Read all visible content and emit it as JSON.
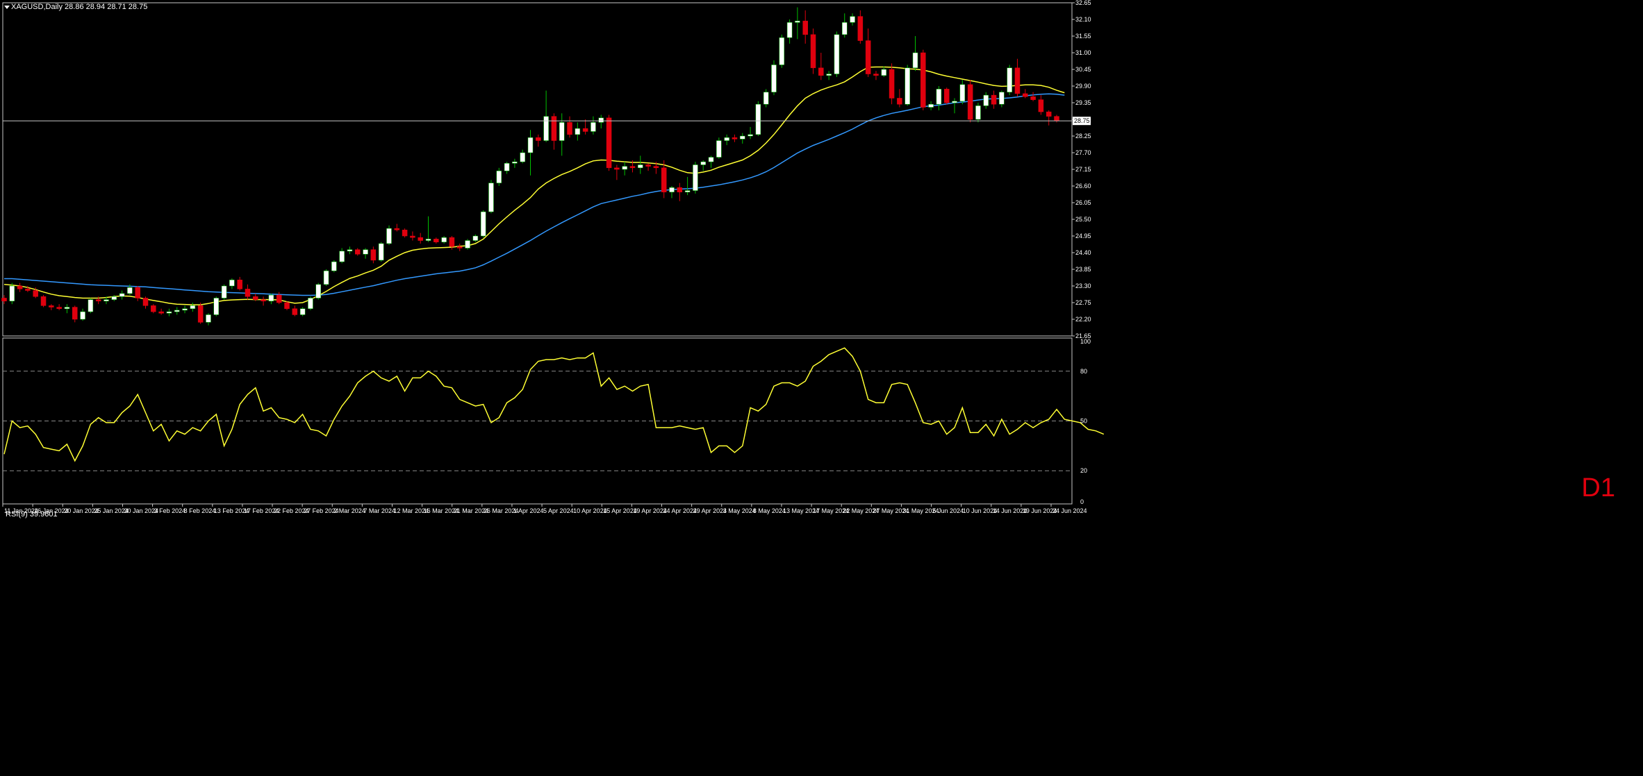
{
  "colors": {
    "background": "#000000",
    "frame": "#c8c8c8",
    "grid": "#8a8a8a",
    "bull": "#ffffff",
    "bear": "#e0000e",
    "wick_bull": "#00c000",
    "wick_bear": "#e0000e",
    "ma_fast": "#ffff33",
    "ma_slow": "#3399ff",
    "rsi_line": "#ffff33",
    "price_line": "#c8c8c8",
    "timeframe": "#e0000e"
  },
  "header": {
    "symbol_timeframe": "XAGUSD,Daily",
    "ohlc": "28.86 28.94 28.71 28.75"
  },
  "timeframe_label": "D1",
  "current_price_label": "28.75",
  "rsi_panel": {
    "label": "RSI(9) 39.9601"
  },
  "chart_data": [
    {
      "type": "candlestick",
      "title": "XAGUSD,Daily",
      "y_range": [
        21.65,
        32.65
      ],
      "y_ticks": [
        "32.65",
        "32.10",
        "31.55",
        "31.00",
        "30.45",
        "29.90",
        "29.35",
        "28.80",
        "28.25",
        "27.70",
        "27.15",
        "26.60",
        "26.05",
        "25.50",
        "24.95",
        "24.40",
        "23.85",
        "23.30",
        "22.75",
        "22.20",
        "21.65"
      ],
      "x_labels": [
        "11 Jan 2024",
        "16 Jan 2024",
        "20 Jan 2024",
        "25 Jan 2024",
        "30 Jan 2024",
        "3 Feb 2024",
        "8 Feb 2024",
        "13 Feb 2024",
        "17 Feb 2024",
        "22 Feb 2024",
        "27 Feb 2024",
        "2 Mar 2024",
        "7 Mar 2024",
        "12 Mar 2024",
        "16 Mar 2024",
        "21 Mar 2024",
        "26 Mar 2024",
        "1 Apr 2024",
        "5 Apr 2024",
        "10 Apr 2024",
        "15 Apr 2024",
        "19 Apr 2024",
        "24 Apr 2024",
        "29 Apr 2024",
        "3 May 2024",
        "8 May 2024",
        "13 May 2024",
        "17 May 2024",
        "22 May 2024",
        "27 May 2024",
        "31 May 2024",
        "5 Jun 2024",
        "10 Jun 2024",
        "14 Jun 2024",
        "19 Jun 2024",
        "24 Jun 2024"
      ],
      "current_price": 28.75,
      "candles": [
        [
          22.9,
          23.0,
          22.7,
          22.8
        ],
        [
          22.8,
          23.4,
          22.7,
          23.3
        ],
        [
          23.3,
          23.4,
          23.1,
          23.2
        ],
        [
          23.2,
          23.3,
          23.1,
          23.15
        ],
        [
          23.15,
          23.25,
          22.9,
          22.95
        ],
        [
          22.95,
          23.0,
          22.6,
          22.65
        ],
        [
          22.65,
          22.7,
          22.5,
          22.6
        ],
        [
          22.6,
          22.7,
          22.5,
          22.55
        ],
        [
          22.55,
          22.7,
          22.4,
          22.6
        ],
        [
          22.6,
          22.65,
          22.1,
          22.2
        ],
        [
          22.2,
          22.55,
          22.15,
          22.45
        ],
        [
          22.45,
          22.9,
          22.4,
          22.85
        ],
        [
          22.85,
          22.95,
          22.7,
          22.8
        ],
        [
          22.8,
          22.95,
          22.7,
          22.85
        ],
        [
          22.85,
          23.0,
          22.8,
          22.95
        ],
        [
          22.95,
          23.15,
          22.85,
          23.05
        ],
        [
          23.05,
          23.35,
          23.0,
          23.25
        ],
        [
          23.25,
          23.3,
          22.8,
          22.9
        ],
        [
          22.9,
          22.95,
          22.55,
          22.65
        ],
        [
          22.65,
          22.7,
          22.4,
          22.45
        ],
        [
          22.45,
          22.55,
          22.35,
          22.4
        ],
        [
          22.4,
          22.55,
          22.3,
          22.45
        ],
        [
          22.45,
          22.6,
          22.35,
          22.5
        ],
        [
          22.5,
          22.65,
          22.4,
          22.55
        ],
        [
          22.55,
          22.75,
          22.45,
          22.65
        ],
        [
          22.65,
          22.75,
          22.05,
          22.1
        ],
        [
          22.1,
          22.4,
          22.0,
          22.35
        ],
        [
          22.35,
          22.95,
          22.3,
          22.9
        ],
        [
          22.9,
          23.35,
          22.85,
          23.3
        ],
        [
          23.3,
          23.55,
          23.2,
          23.5
        ],
        [
          23.5,
          23.6,
          23.15,
          23.2
        ],
        [
          23.2,
          23.35,
          22.85,
          22.95
        ],
        [
          22.95,
          23.05,
          22.8,
          22.85
        ],
        [
          22.85,
          22.95,
          22.65,
          22.8
        ],
        [
          22.8,
          23.05,
          22.7,
          23.0
        ],
        [
          23.0,
          23.1,
          22.7,
          22.75
        ],
        [
          22.75,
          22.8,
          22.5,
          22.55
        ],
        [
          22.55,
          22.65,
          22.3,
          22.35
        ],
        [
          22.35,
          22.6,
          22.3,
          22.55
        ],
        [
          22.55,
          22.95,
          22.5,
          22.9
        ],
        [
          22.9,
          23.4,
          22.85,
          23.35
        ],
        [
          23.35,
          23.85,
          23.3,
          23.8
        ],
        [
          23.8,
          24.15,
          23.75,
          24.1
        ],
        [
          24.1,
          24.55,
          24.05,
          24.45
        ],
        [
          24.45,
          24.6,
          24.35,
          24.5
        ],
        [
          24.5,
          24.55,
          24.3,
          24.35
        ],
        [
          24.35,
          24.55,
          24.2,
          24.5
        ],
        [
          24.5,
          24.6,
          24.05,
          24.15
        ],
        [
          24.15,
          24.75,
          24.1,
          24.7
        ],
        [
          24.7,
          25.3,
          24.65,
          25.2
        ],
        [
          25.2,
          25.35,
          25.1,
          25.15
        ],
        [
          25.15,
          25.2,
          24.9,
          24.95
        ],
        [
          24.95,
          25.1,
          24.8,
          24.9
        ],
        [
          24.9,
          25.05,
          24.7,
          24.8
        ],
        [
          24.8,
          25.6,
          24.75,
          24.85
        ],
        [
          24.85,
          24.9,
          24.7,
          24.75
        ],
        [
          24.75,
          24.95,
          24.7,
          24.9
        ],
        [
          24.9,
          24.95,
          24.5,
          24.6
        ],
        [
          24.6,
          24.7,
          24.45,
          24.55
        ],
        [
          24.55,
          24.85,
          24.5,
          24.8
        ],
        [
          24.8,
          25.0,
          24.75,
          24.95
        ],
        [
          24.95,
          25.8,
          24.9,
          25.75
        ],
        [
          25.75,
          26.8,
          25.7,
          26.7
        ],
        [
          26.7,
          27.2,
          26.6,
          27.1
        ],
        [
          27.1,
          27.4,
          27.0,
          27.35
        ],
        [
          27.35,
          27.5,
          27.2,
          27.4
        ],
        [
          27.4,
          27.8,
          27.35,
          27.7
        ],
        [
          27.7,
          28.45,
          26.95,
          28.2
        ],
        [
          28.2,
          28.3,
          27.9,
          28.1
        ],
        [
          28.1,
          29.75,
          28.05,
          28.9
        ],
        [
          28.9,
          29.0,
          27.8,
          28.1
        ],
        [
          28.1,
          29.0,
          27.6,
          28.7
        ],
        [
          28.7,
          28.9,
          28.2,
          28.3
        ],
        [
          28.3,
          28.7,
          28.1,
          28.5
        ],
        [
          28.5,
          28.8,
          28.3,
          28.4
        ],
        [
          28.4,
          28.9,
          28.3,
          28.7
        ],
        [
          28.7,
          28.95,
          28.5,
          28.85
        ],
        [
          28.85,
          28.95,
          27.1,
          27.2
        ],
        [
          27.2,
          27.3,
          26.8,
          27.15
        ],
        [
          27.15,
          27.4,
          26.95,
          27.25
        ],
        [
          27.25,
          27.45,
          27.05,
          27.2
        ],
        [
          27.2,
          27.6,
          27.0,
          27.3
        ],
        [
          27.3,
          27.35,
          27.1,
          27.25
        ],
        [
          27.25,
          27.4,
          27.0,
          27.2
        ],
        [
          27.2,
          27.45,
          26.2,
          26.4
        ],
        [
          26.4,
          26.6,
          26.2,
          26.55
        ],
        [
          26.55,
          26.7,
          26.1,
          26.4
        ],
        [
          26.4,
          26.9,
          26.3,
          26.45
        ],
        [
          26.45,
          27.4,
          26.35,
          27.3
        ],
        [
          27.3,
          27.45,
          27.1,
          27.4
        ],
        [
          27.4,
          27.6,
          27.2,
          27.55
        ],
        [
          27.55,
          28.2,
          27.5,
          28.1
        ],
        [
          28.1,
          28.3,
          27.95,
          28.2
        ],
        [
          28.2,
          28.3,
          28.05,
          28.15
        ],
        [
          28.15,
          28.35,
          28.0,
          28.25
        ],
        [
          28.25,
          28.55,
          28.15,
          28.3
        ],
        [
          28.3,
          29.4,
          28.25,
          29.3
        ],
        [
          29.3,
          29.8,
          29.2,
          29.7
        ],
        [
          29.7,
          30.75,
          29.6,
          30.6
        ],
        [
          30.6,
          31.6,
          30.5,
          31.5
        ],
        [
          31.5,
          32.1,
          31.3,
          32.0
        ],
        [
          32.0,
          32.5,
          31.45,
          32.05
        ],
        [
          32.05,
          32.4,
          31.3,
          31.6
        ],
        [
          31.6,
          31.8,
          30.3,
          30.5
        ],
        [
          30.5,
          31.0,
          30.1,
          30.25
        ],
        [
          30.25,
          30.4,
          30.1,
          30.3
        ],
        [
          30.3,
          31.7,
          30.2,
          31.6
        ],
        [
          31.6,
          32.3,
          31.5,
          32.0
        ],
        [
          32.0,
          32.3,
          31.9,
          32.2
        ],
        [
          32.2,
          32.4,
          31.3,
          31.4
        ],
        [
          31.4,
          31.8,
          30.2,
          30.3
        ],
        [
          30.3,
          30.4,
          30.1,
          30.25
        ],
        [
          30.25,
          30.55,
          30.2,
          30.45
        ],
        [
          30.45,
          30.65,
          29.3,
          29.5
        ],
        [
          29.5,
          29.8,
          29.2,
          29.3
        ],
        [
          29.3,
          30.6,
          29.25,
          30.5
        ],
        [
          30.5,
          31.55,
          30.4,
          31.0
        ],
        [
          31.0,
          31.1,
          29.1,
          29.2
        ],
        [
          29.2,
          29.4,
          29.1,
          29.3
        ],
        [
          29.3,
          29.9,
          29.1,
          29.8
        ],
        [
          29.8,
          29.85,
          29.3,
          29.35
        ],
        [
          29.35,
          29.5,
          29.0,
          29.4
        ],
        [
          29.4,
          30.1,
          29.3,
          29.95
        ],
        [
          29.95,
          30.1,
          28.7,
          28.8
        ],
        [
          28.8,
          29.35,
          28.7,
          29.25
        ],
        [
          29.25,
          29.7,
          29.15,
          29.6
        ],
        [
          29.6,
          29.75,
          29.15,
          29.3
        ],
        [
          29.3,
          29.75,
          29.2,
          29.7
        ],
        [
          29.7,
          30.6,
          29.6,
          30.5
        ],
        [
          30.5,
          30.8,
          29.55,
          29.65
        ],
        [
          29.65,
          29.8,
          29.5,
          29.55
        ],
        [
          29.55,
          29.7,
          29.4,
          29.45
        ],
        [
          29.45,
          29.6,
          28.95,
          29.05
        ],
        [
          29.05,
          29.1,
          28.6,
          28.9
        ],
        [
          28.9,
          28.95,
          28.7,
          28.75
        ]
      ],
      "ma_fast": [
        23.35,
        23.33,
        23.3,
        23.25,
        23.18,
        23.1,
        23.03,
        22.98,
        22.95,
        22.92,
        22.9,
        22.9,
        22.9,
        22.92,
        22.95,
        22.97,
        22.96,
        22.92,
        22.87,
        22.82,
        22.78,
        22.73,
        22.7,
        22.69,
        22.68,
        22.68,
        22.72,
        22.78,
        22.82,
        22.84,
        22.85,
        22.86,
        22.85,
        22.85,
        22.85,
        22.84,
        22.78,
        22.73,
        22.75,
        22.85,
        22.98,
        23.12,
        23.28,
        23.42,
        23.55,
        23.63,
        23.73,
        23.82,
        23.95,
        24.15,
        24.28,
        24.4,
        24.48,
        24.52,
        24.55,
        24.56,
        24.57,
        24.58,
        24.61,
        24.63,
        24.7,
        24.85,
        25.1,
        25.35,
        25.58,
        25.8,
        26.0,
        26.22,
        26.5,
        26.7,
        26.85,
        26.98,
        27.08,
        27.2,
        27.33,
        27.43,
        27.46,
        27.45,
        27.42,
        27.4,
        27.38,
        27.38,
        27.36,
        27.34,
        27.3,
        27.22,
        27.12,
        27.04,
        27.02,
        27.06,
        27.12,
        27.22,
        27.3,
        27.38,
        27.46,
        27.6,
        27.78,
        28.02,
        28.3,
        28.62,
        28.95,
        29.25,
        29.5,
        29.65,
        29.77,
        29.86,
        29.94,
        30.04,
        30.2,
        30.38,
        30.52,
        30.53,
        30.53,
        30.52,
        30.5,
        30.47,
        30.46,
        30.43,
        30.37,
        30.29,
        30.23,
        30.18,
        30.13,
        30.08,
        30.03,
        29.97,
        29.92,
        29.89,
        29.9,
        29.92,
        29.94,
        29.94,
        29.92,
        29.86,
        29.76,
        29.68
      ],
      "ma_slow": [
        23.54,
        23.54,
        23.52,
        23.5,
        23.48,
        23.46,
        23.44,
        23.42,
        23.4,
        23.38,
        23.36,
        23.34,
        23.33,
        23.32,
        23.31,
        23.3,
        23.29,
        23.28,
        23.27,
        23.25,
        23.23,
        23.21,
        23.19,
        23.17,
        23.15,
        23.13,
        23.11,
        23.1,
        23.09,
        23.08,
        23.07,
        23.06,
        23.05,
        23.04,
        23.03,
        23.02,
        23.01,
        23.0,
        22.99,
        22.99,
        23.0,
        23.02,
        23.06,
        23.11,
        23.16,
        23.21,
        23.26,
        23.31,
        23.37,
        23.43,
        23.49,
        23.54,
        23.58,
        23.62,
        23.66,
        23.7,
        23.73,
        23.76,
        23.79,
        23.84,
        23.9,
        24.0,
        24.12,
        24.25,
        24.38,
        24.52,
        24.66,
        24.8,
        24.96,
        25.11,
        25.25,
        25.39,
        25.52,
        25.65,
        25.78,
        25.91,
        26.02,
        26.08,
        26.14,
        26.2,
        26.26,
        26.31,
        26.37,
        26.42,
        26.46,
        26.48,
        26.5,
        26.51,
        26.53,
        26.56,
        26.6,
        26.64,
        26.69,
        26.74,
        26.8,
        26.87,
        26.96,
        27.07,
        27.21,
        27.37,
        27.53,
        27.69,
        27.82,
        27.94,
        28.04,
        28.14,
        28.25,
        28.36,
        28.48,
        28.62,
        28.75,
        28.85,
        28.93,
        29.0,
        29.05,
        29.1,
        29.16,
        29.22,
        29.25,
        29.27,
        29.31,
        29.35,
        29.37,
        29.4,
        29.44,
        29.47,
        29.48,
        29.49,
        29.51,
        29.54,
        29.58,
        29.61,
        29.63,
        29.64,
        29.63,
        29.6
      ],
      "rsi": {
        "title": "RSI(9) 39.9601",
        "y_range": [
          0,
          100
        ],
        "y_ticks": [
          "100",
          "80",
          "50",
          "20",
          "0"
        ],
        "levels": [
          80,
          50,
          20
        ],
        "values": [
          30,
          50,
          46,
          47,
          42,
          34,
          33,
          32,
          36,
          26,
          35,
          48,
          52,
          49,
          49,
          55,
          59,
          66,
          55,
          44,
          48,
          38,
          44,
          42,
          46,
          44,
          50,
          54,
          35,
          45,
          60,
          66,
          70,
          56,
          58,
          52,
          51,
          49,
          54,
          45,
          44,
          41,
          51,
          59,
          65,
          73,
          77,
          80,
          76,
          74,
          77,
          68,
          76,
          76,
          80,
          77,
          71,
          70,
          63,
          61,
          59,
          60,
          49,
          52,
          61,
          64,
          69,
          81,
          86,
          87,
          87,
          88,
          87,
          88,
          88,
          91,
          71,
          76,
          69,
          71,
          68,
          71,
          72,
          46,
          46,
          46,
          47,
          46,
          45,
          46,
          31,
          35,
          35,
          31,
          35,
          58,
          56,
          60,
          71,
          73,
          73,
          71,
          74,
          83,
          86,
          90,
          92,
          94,
          89,
          80,
          63,
          61,
          61,
          72,
          73,
          72,
          61,
          49,
          48,
          50,
          42,
          46,
          58,
          43,
          43,
          48,
          41,
          51,
          42,
          45,
          49,
          46,
          49,
          51,
          57,
          51,
          50,
          49,
          45,
          44,
          42
        ]
      }
    }
  ]
}
